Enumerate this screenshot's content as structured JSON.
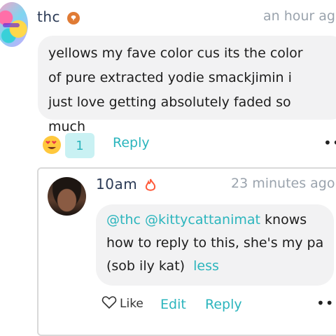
{
  "comment": {
    "username": "thc",
    "badge_icon": "chat-badge-icon",
    "timestamp": "an hour ag",
    "text": "yellows my fave color cus its the color of pure extracted yodie smackjimin i just love getting absolutely faded so much",
    "reaction_icon": "heart-eyes-emoji-icon",
    "reaction_count": "1",
    "reply_label": "Reply",
    "more_label": "••"
  },
  "reply": {
    "username": "10am",
    "flame_icon": "flame-icon",
    "timestamp": "23 minutes ago",
    "mention1": "@thc",
    "mention2": "@kittycattanimat",
    "text_after_mentions": " knows how to reply to this, she's my pa (sob ily kat)",
    "less_label": "less",
    "like_label": "Like",
    "edit_label": "Edit",
    "reply_label": "Reply",
    "more_label": "•••"
  },
  "colors": {
    "accent": "#2bb5bd",
    "bubble_bg": "#f2f2f3",
    "timestamp": "#9aa3ad"
  }
}
